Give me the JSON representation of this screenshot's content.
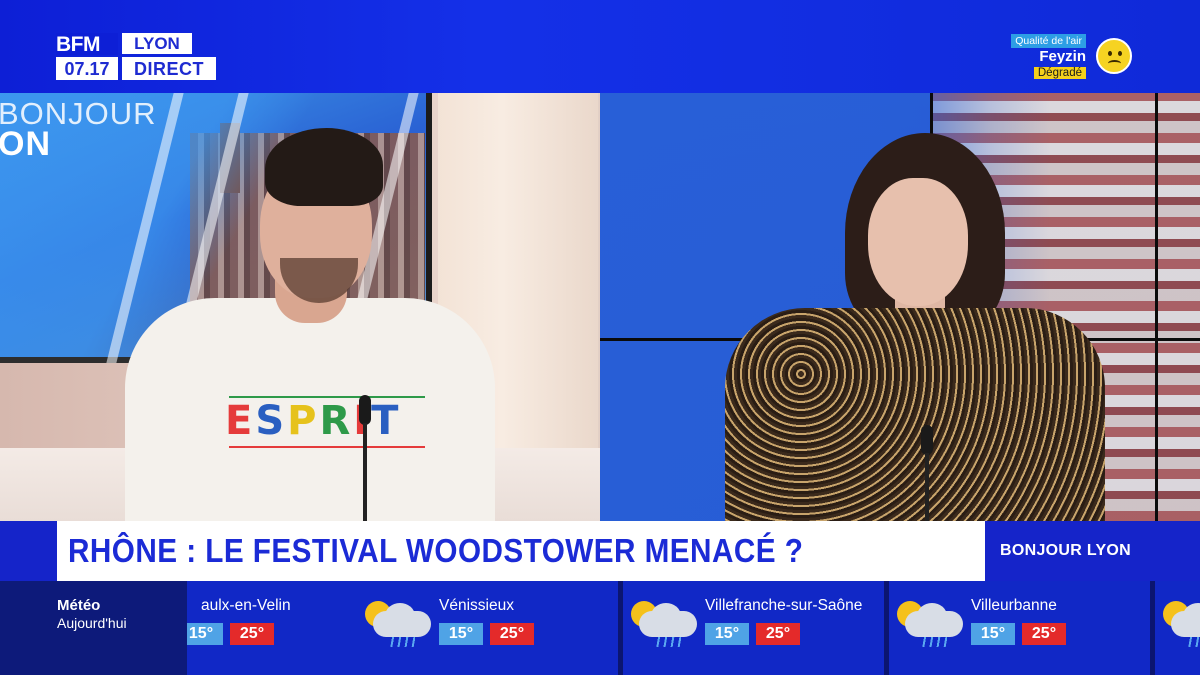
{
  "channel": {
    "brand": "BFM",
    "city": "LYON",
    "time": "07.17",
    "live": "DIRECT"
  },
  "air_quality": {
    "label": "Qualité de l'air",
    "place": "Feyzin",
    "status": "Dégradé",
    "status_color": "#f4d11c",
    "icon": "sad-face-icon"
  },
  "studio": {
    "background_show_title_line1": "BONJOUR",
    "background_show_title_line2": "ON",
    "sweater_logo": [
      "E",
      "S",
      "P",
      "R",
      "I",
      "T"
    ]
  },
  "headline": {
    "text": "RHÔNE : LE FESTIVAL WOODSTOWER MENACÉ ?",
    "color": "#1b2bd6"
  },
  "show": {
    "name": "BONJOUR LYON"
  },
  "weather": {
    "title": "Météo",
    "subtitle": "Aujourd'hui",
    "icon": "sun-cloud-rain-icon",
    "items": [
      {
        "town": "aulx-en-Velin",
        "min": "15°",
        "max": "25°"
      },
      {
        "town": "Vénissieux",
        "min": "15°",
        "max": "25°"
      },
      {
        "town": "Villefranche-sur-Saône",
        "min": "15°",
        "max": "25°"
      },
      {
        "town": "Villeurbanne",
        "min": "15°",
        "max": "25°"
      },
      {
        "town": "",
        "min": "",
        "max": ""
      }
    ]
  }
}
